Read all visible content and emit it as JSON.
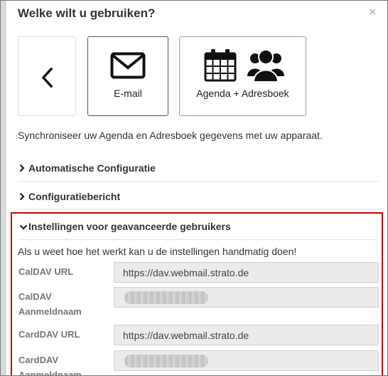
{
  "dialog": {
    "title": "Welke wilt u gebruiken?",
    "close_label": "×"
  },
  "options": [
    {
      "label": "",
      "icon": "chevron-left-icon"
    },
    {
      "label": "E-mail",
      "icon": "envelope-icon"
    },
    {
      "label": "Agenda + Adresboek",
      "icons": [
        "calendar-icon",
        "users-icon"
      ],
      "selected": true
    }
  ],
  "description": "Synchroniseer uw Agenda en Adresboek gegevens met uw apparaat.",
  "sections": [
    {
      "label": "Automatische Configuratie",
      "expanded": false
    },
    {
      "label": "Configuratiebericht",
      "expanded": false
    }
  ],
  "advanced": {
    "label": "Instellingen voor geavanceerde gebruikers",
    "expanded": true,
    "intro": "Als u weet hoe het werkt kan u de instellingen handmatig doen!",
    "fields": [
      {
        "label": "CalDAV URL",
        "value": "https://dav.webmail.strato.de"
      },
      {
        "label": "CalDAV Aanmeldnaam",
        "value": ""
      },
      {
        "label": "CardDAV URL",
        "value": "https://dav.webmail.strato.de"
      },
      {
        "label": "CardDAV Aanmeldnaam",
        "value": ""
      }
    ]
  },
  "colors": {
    "highlight_border": "#cc0000",
    "input_background": "#ebebeb",
    "label_gray": "#777777"
  }
}
